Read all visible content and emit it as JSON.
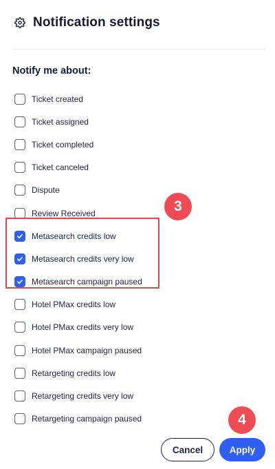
{
  "header": {
    "title": "Notification settings",
    "icon": "gear-icon"
  },
  "section": {
    "heading": "Notify me about:"
  },
  "options": [
    {
      "label": "Ticket created",
      "checked": false
    },
    {
      "label": "Ticket assigned",
      "checked": false
    },
    {
      "label": "Ticket completed",
      "checked": false
    },
    {
      "label": "Ticket canceled",
      "checked": false
    },
    {
      "label": "Dispute",
      "checked": false
    },
    {
      "label": "Review Received",
      "checked": false
    },
    {
      "label": "Metasearch credits low",
      "checked": true
    },
    {
      "label": "Metasearch credits very low",
      "checked": true
    },
    {
      "label": "Metasearch campaign paused",
      "checked": true
    },
    {
      "label": "Hotel PMax credits low",
      "checked": false
    },
    {
      "label": "Hotel PMax credits very low",
      "checked": false
    },
    {
      "label": "Hotel PMax campaign paused",
      "checked": false
    },
    {
      "label": "Retargeting credits low",
      "checked": false
    },
    {
      "label": "Retargeting credits very low",
      "checked": false
    },
    {
      "label": "Retargeting campaign paused",
      "checked": false
    }
  ],
  "annotations": {
    "step_3": "3",
    "step_4": "4"
  },
  "buttons": {
    "cancel": "Cancel",
    "apply": "Apply"
  },
  "colors": {
    "accent": "#2f5ff0",
    "annotation": "#ef4b54",
    "text": "#1b2440"
  }
}
